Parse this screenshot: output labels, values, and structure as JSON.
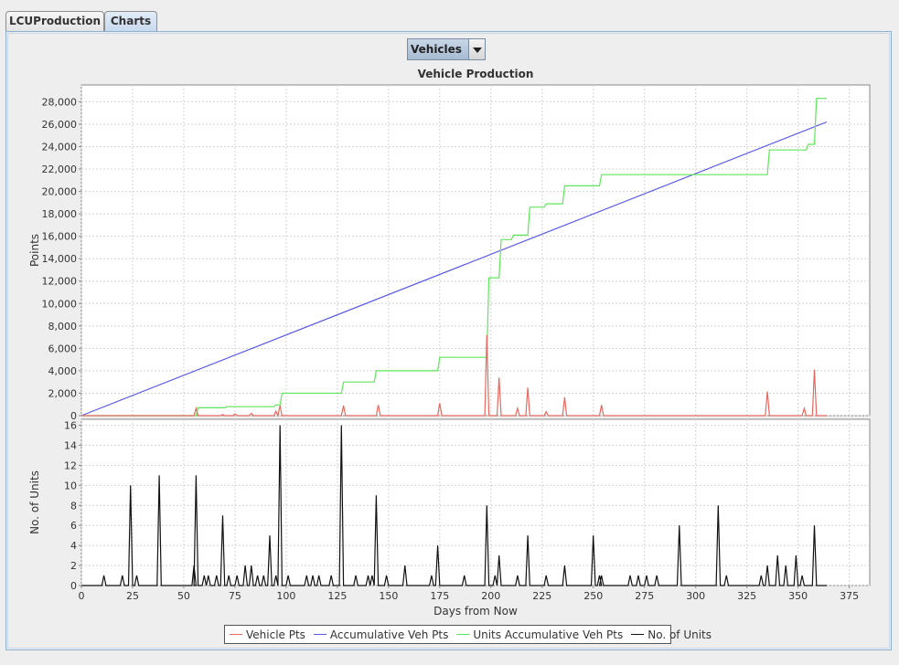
{
  "tabs": [
    {
      "label": "LCUProduction",
      "active": false
    },
    {
      "label": "Charts",
      "active": true
    }
  ],
  "selector": {
    "selected": "Vehicles"
  },
  "chart_data": {
    "type": "line",
    "title": "Vehicle Production",
    "xlabel": "Days from Now",
    "xlim": [
      0,
      385
    ],
    "x_ticks": [
      0,
      25,
      50,
      75,
      100,
      125,
      150,
      175,
      200,
      225,
      250,
      275,
      300,
      325,
      350,
      375
    ],
    "grid": true,
    "legend_placement": "bottom",
    "legend": [
      {
        "label": "Vehicle Pts",
        "color": "#e8695f"
      },
      {
        "label": "Accumulative Veh Pts",
        "color": "#5a5ae6"
      },
      {
        "label": "Units Accumulative Veh Pts",
        "color": "#5fe65a"
      },
      {
        "label": "No. of Units",
        "color": "#111111"
      }
    ],
    "panels": [
      {
        "ylabel": "Points",
        "ylim": [
          0,
          29500
        ],
        "y_ticks": [
          0,
          2000,
          4000,
          6000,
          8000,
          10000,
          12000,
          14000,
          16000,
          18000,
          20000,
          22000,
          24000,
          26000,
          28000
        ],
        "y_tick_labels": [
          "0",
          "2,000",
          "4,000",
          "6,000",
          "8,000",
          "10,000",
          "12,000",
          "14,000",
          "16,000",
          "18,000",
          "20,000",
          "22,000",
          "24,000",
          "26,000",
          "28,000"
        ],
        "series": [
          {
            "name": "Accumulative Veh Pts",
            "color": "#5a5ae6",
            "x": [
              0,
              364
            ],
            "y": [
              0,
              26200
            ]
          },
          {
            "name": "Units Accumulative Veh Pts",
            "color": "#5fe65a",
            "step": true,
            "x": [
              0,
              56,
              57,
              70,
              71,
              94,
              95,
              97,
              98,
              127,
              128,
              143,
              144,
              174,
              175,
              198,
              199,
              204,
              205,
              210,
              211,
              218,
              219,
              226,
              227,
              235,
              236,
              253,
              254,
              335,
              336,
              354,
              355,
              358,
              359,
              364
            ],
            "y": [
              0,
              0,
              700,
              700,
              800,
              800,
              950,
              950,
              2000,
              2000,
              3000,
              3000,
              4000,
              4000,
              5200,
              5200,
              12300,
              12300,
              15700,
              15700,
              16100,
              16100,
              18600,
              18600,
              18900,
              18900,
              20500,
              20500,
              21500,
              21500,
              23700,
              23700,
              24200,
              24200,
              28300,
              28300
            ]
          },
          {
            "name": "Vehicle Pts",
            "color": "#e8695f",
            "spikes": true,
            "x": [
              56,
              69,
              75,
              83,
              95,
              97,
              128,
              145,
              175,
              198,
              204,
              213,
              218,
              227,
              236,
              254,
              335,
              353,
              358
            ],
            "y": [
              650,
              100,
              150,
              200,
              400,
              900,
              900,
              950,
              1100,
              7200,
              3400,
              650,
              2500,
              350,
              1650,
              950,
              2150,
              650,
              4100
            ]
          }
        ]
      },
      {
        "ylabel": "No. of Units",
        "ylim": [
          0,
          16.6
        ],
        "y_ticks": [
          0,
          2,
          4,
          6,
          8,
          10,
          12,
          14,
          16
        ],
        "y_tick_labels": [
          "0",
          "2",
          "4",
          "6",
          "8",
          "10",
          "12",
          "14",
          "16"
        ],
        "series": [
          {
            "name": "No. of Units",
            "color": "#111111",
            "spikes": true,
            "x": [
              11,
              20,
              24,
              27,
              38,
              55,
              56,
              60,
              62,
              66,
              69,
              72,
              76,
              80,
              83,
              86,
              89,
              92,
              95,
              97,
              101,
              110,
              113,
              116,
              122,
              127,
              134,
              140,
              142,
              144,
              149,
              158,
              171,
              174,
              187,
              198,
              202,
              204,
              213,
              218,
              227,
              236,
              250,
              253,
              254,
              268,
              272,
              276,
              281,
              292,
              311,
              315,
              332,
              335,
              340,
              344,
              349,
              352,
              358
            ],
            "y": [
              1,
              1,
              10,
              1,
              11,
              2,
              11,
              1,
              1,
              1,
              7,
              1,
              1,
              2,
              2,
              1,
              1,
              5,
              1,
              16,
              1,
              1,
              1,
              1,
              1,
              16,
              1,
              1,
              1,
              9,
              1,
              2,
              1,
              4,
              1,
              8,
              1,
              3,
              1,
              5,
              1,
              2,
              5,
              1,
              1,
              1,
              1,
              1,
              1,
              6,
              8,
              1,
              1,
              2,
              3,
              2,
              3,
              1,
              6
            ]
          }
        ]
      }
    ]
  }
}
